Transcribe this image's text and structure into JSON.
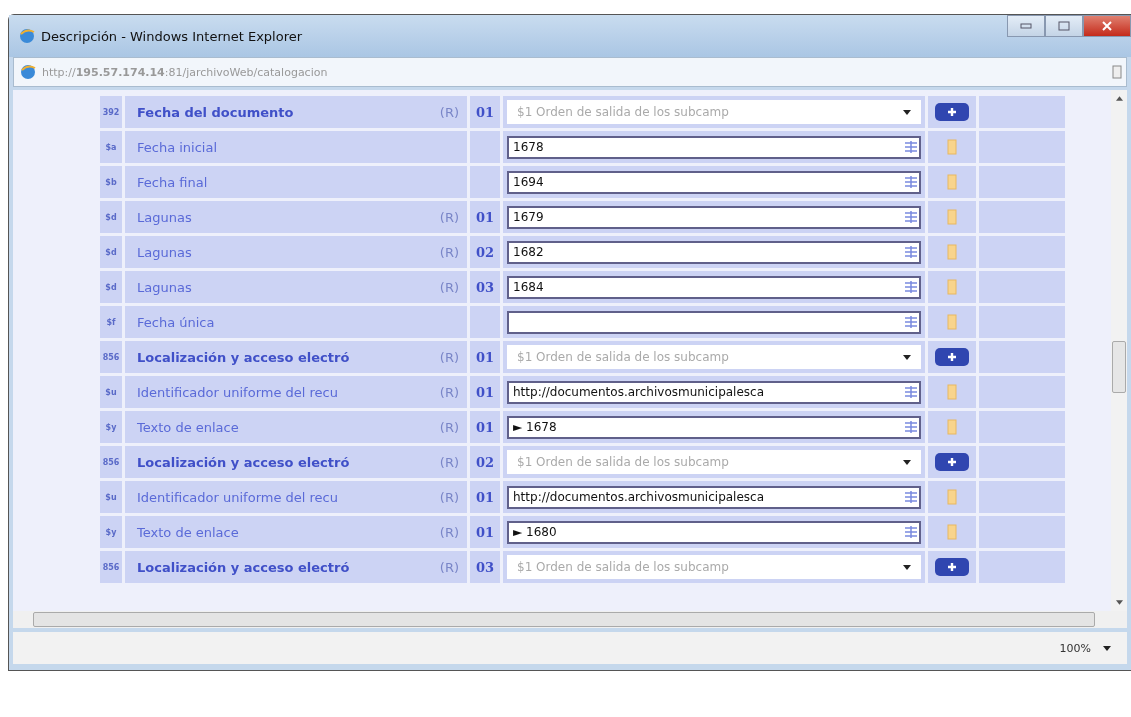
{
  "window": {
    "title": "Descripción - Windows Internet Explorer"
  },
  "address": {
    "url": "http://**195.57.174.14**:81/jarchivoWeb/catalogacion"
  },
  "rows": [
    {
      "kind": "field",
      "tag": "392",
      "label": "Fecha del documento",
      "repeat": "(R)",
      "occurrence": "01",
      "value": "$1 Orden de salida de los subcamp"
    },
    {
      "kind": "subfield",
      "tag": "$a",
      "label": "Fecha inicial",
      "value": "1678"
    },
    {
      "kind": "subfield",
      "tag": "$b",
      "label": "Fecha final",
      "value": "1694"
    },
    {
      "kind": "subfield",
      "tag": "$d",
      "label": "Lagunas",
      "repeat": "(R)",
      "occurrence": "01",
      "value": "1679"
    },
    {
      "kind": "subfield",
      "tag": "$d",
      "label": "Lagunas",
      "repeat": "(R)",
      "occurrence": "02",
      "value": "1682"
    },
    {
      "kind": "subfield",
      "tag": "$d",
      "label": "Lagunas",
      "repeat": "(R)",
      "occurrence": "03",
      "value": "1684"
    },
    {
      "kind": "subfield",
      "tag": "$f",
      "label": "Fecha única"
    },
    {
      "kind": "field",
      "tag": "856",
      "label": "Localización y acceso electró",
      "repeat": "(R)",
      "occurrence": "01",
      "value": "$1 Orden de salida de los subcamp"
    },
    {
      "kind": "subfield",
      "tag": "$u",
      "label": "Identificador uniforme del recu",
      "repeat": "(R)",
      "occurrence": "01",
      "value": "http://documentos.archivosmunicipalesca"
    },
    {
      "kind": "subfield",
      "tag": "$y",
      "label": "Texto de enlace",
      "repeat": "(R)",
      "occurrence": "01",
      "value": "► 1678"
    },
    {
      "kind": "field",
      "tag": "856",
      "label": "Localización y acceso electró",
      "repeat": "(R)",
      "occurrence": "02",
      "value": "$1 Orden de salida de los subcamp"
    },
    {
      "kind": "subfield",
      "tag": "$u",
      "label": "Identificador uniforme del recu",
      "repeat": "(R)",
      "occurrence": "01",
      "value": "http://documentos.archivosmunicipalesca"
    },
    {
      "kind": "subfield",
      "tag": "$y",
      "label": "Texto de enlace",
      "repeat": "(R)",
      "occurrence": "01",
      "value": "► 1680"
    },
    {
      "kind": "field",
      "tag": "856",
      "label": "Localización y acceso electró",
      "repeat": "(R)",
      "occurrence": "03",
      "value": "$1 Orden de salida de los subcamp"
    }
  ],
  "status_bar": {
    "zoom": "100%"
  }
}
